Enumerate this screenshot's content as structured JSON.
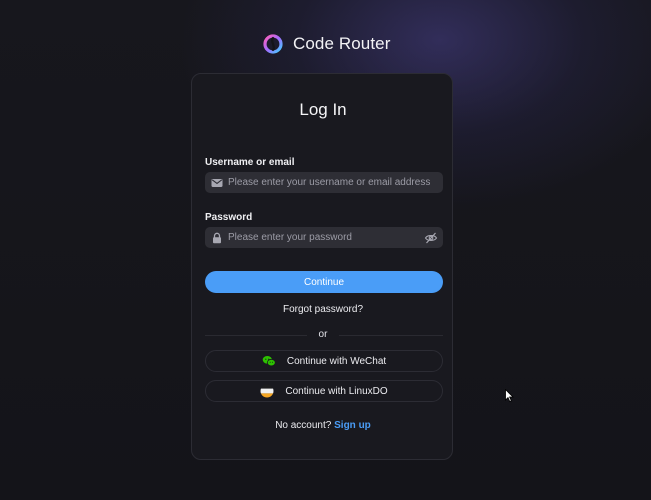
{
  "brand": {
    "name": "Code Router",
    "logo_icon": "code-router-logo-icon"
  },
  "login": {
    "title": "Log In",
    "username": {
      "label": "Username or email",
      "placeholder": "Please enter your username or email address",
      "value": "",
      "icon": "mail-icon"
    },
    "password": {
      "label": "Password",
      "placeholder": "Please enter your password",
      "value": "",
      "icon": "lock-icon",
      "toggle_icon": "eye-off-icon"
    },
    "continue_label": "Continue",
    "forgot_label": "Forgot password?",
    "divider_label": "or",
    "wechat_label": "Continue with WeChat",
    "linuxdo_label": "Continue with LinuxDO",
    "no_account_text": "No account?",
    "signup_label": "Sign up"
  },
  "colors": {
    "background": "#141419",
    "card": "#19191f",
    "input": "#2e2e35",
    "accent": "#4a9df7",
    "wechat": "#2dc100",
    "linuxdo_top": "#1c1c1e",
    "linuxdo_middle": "#f0f0f0",
    "linuxdo_bottom": "#f5a623"
  }
}
